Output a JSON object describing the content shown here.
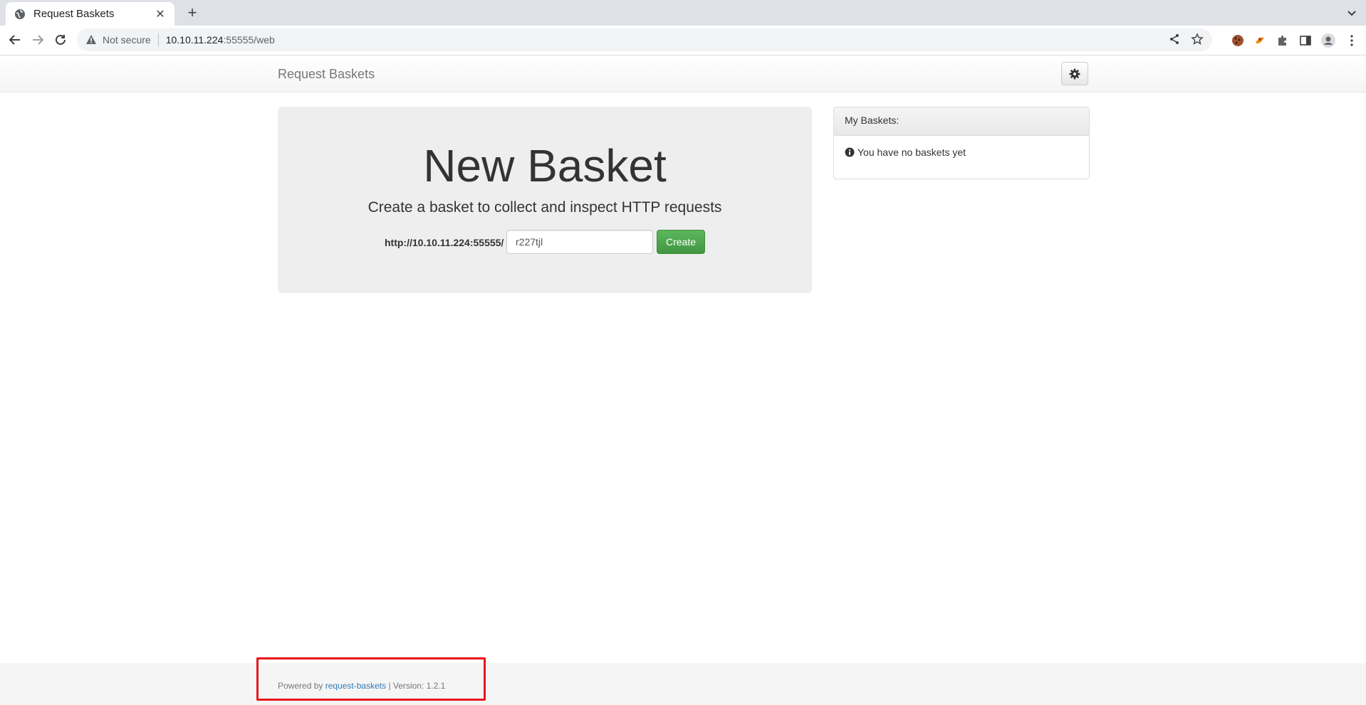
{
  "browser": {
    "tab_title": "Request Baskets",
    "security_label": "Not secure",
    "url_host": "10.10.11.224",
    "url_path": ":55555/web"
  },
  "app": {
    "brand": "Request Baskets"
  },
  "jumbotron": {
    "heading": "New Basket",
    "lead": "Create a basket to collect and inspect HTTP requests",
    "base_url": "http://10.10.11.224:55555/",
    "basket_name_value": "r227tjl",
    "create_label": "Create"
  },
  "baskets_panel": {
    "heading": "My Baskets:",
    "empty_text": "You have no baskets yet"
  },
  "footer": {
    "powered_by": "Powered by",
    "link_text": "request-baskets",
    "version_text": "| Version: 1.2.1"
  },
  "colors": {
    "create_button": "#449d44",
    "link": "#337ab7",
    "highlight_box": "#e8131b"
  },
  "icons": [
    "globe-icon",
    "close-icon",
    "new-tab-icon",
    "tab-search-icon",
    "back-icon",
    "forward-icon",
    "reload-icon",
    "warning-icon",
    "share-icon",
    "bookmark-star-icon",
    "cookie-extension-icon",
    "extension-icon",
    "puzzle-icon",
    "side-panel-icon",
    "profile-icon",
    "kebab-menu-icon",
    "gear-icon",
    "info-circle-icon"
  ]
}
